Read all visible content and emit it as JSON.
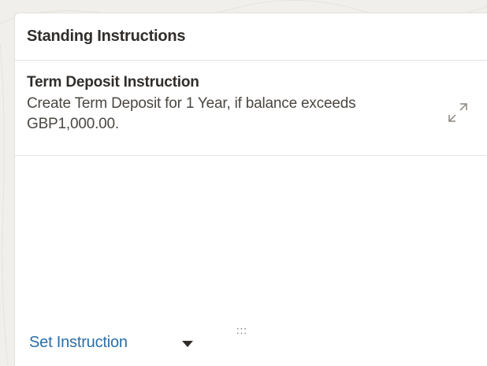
{
  "card": {
    "title": "Standing Instructions"
  },
  "instruction": {
    "title": "Term Deposit Instruction",
    "description": "Create Term Deposit for 1 Year, if balance exceeds GBP1,000.00.",
    "expand_icon": "expand-icon"
  },
  "footer": {
    "action_label": "Set Instruction",
    "dropdown_icon": "caret-down-icon",
    "drag_handle": ":::"
  },
  "colors": {
    "link": "#2b6ea8",
    "text": "#312d2a",
    "border": "#e6e3de",
    "background": "#f1efec"
  }
}
